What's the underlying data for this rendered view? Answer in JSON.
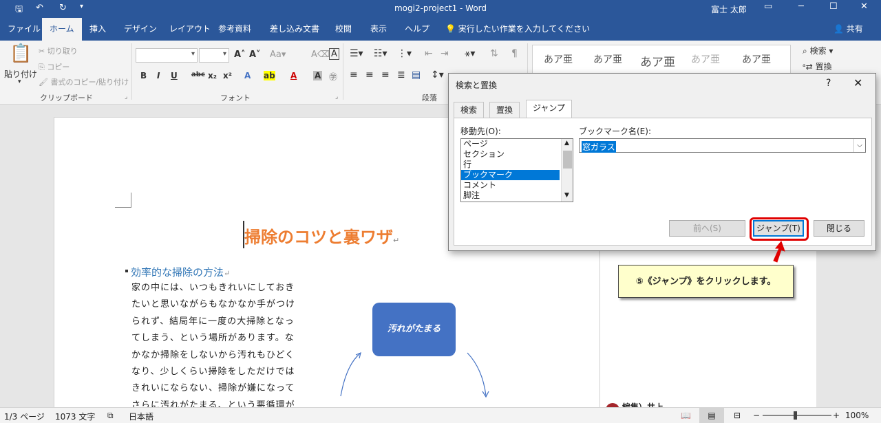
{
  "window": {
    "title": "mogi2-project1  -  Word",
    "user": "富士 太郎"
  },
  "tabs": [
    "ファイル",
    "ホーム",
    "挿入",
    "デザイン",
    "レイアウト",
    "参考資料",
    "差し込み文書",
    "校閲",
    "表示",
    "ヘルプ"
  ],
  "tell_me": "実行したい作業を入力してください",
  "share": "共有",
  "ribbon": {
    "clipboard": {
      "paste": "貼り付け",
      "cut": "切り取り",
      "copy": "コピー",
      "format_painter": "書式のコピー/貼り付け",
      "group": "クリップボード"
    },
    "font": {
      "group": "フォント"
    },
    "paragraph": {
      "group": "段落"
    },
    "styles": [
      "あア亜",
      "あア亜",
      "あア亜",
      "あア亜",
      "あア亜"
    ],
    "editing": {
      "find": "検索",
      "replace": "置換"
    }
  },
  "document": {
    "title": "掃除のコツと裏ワザ",
    "subheading": "効率的な掃除の方法",
    "body": "家の中には、いつもきれいにしておきたいと思いながらもなかなか手がつけられず、結局年に一度の大掃除となってしまう、という場所があります。なかなか掃除をしないから汚れもひどくなり、少しくらい掃除をしただけではきれいにならない、掃除が嫌になってさらに汚れがたまる、という悪循環が発",
    "shape_text": "汚れがたまる"
  },
  "callout": "⑤《ジャンプ》をクリックします。",
  "pane": {
    "edit_label": "編集）井上"
  },
  "dialog": {
    "title": "検索と置換",
    "help": "?",
    "close": "✕",
    "tabs": [
      "検索",
      "置換",
      "ジャンプ"
    ],
    "goto_label": "移動先(O):",
    "goto_items": [
      "ページ",
      "セクション",
      "行",
      "ブックマーク",
      "コメント",
      "脚注"
    ],
    "selected_index": 3,
    "bookmark_label": "ブックマーク名(E):",
    "bookmark_value": "窓ガラス",
    "buttons": {
      "previous": "前へ(S)",
      "jump": "ジャンプ(T)",
      "close": "閉じる"
    }
  },
  "status": {
    "page": "1/3 ページ",
    "words": "1073 文字",
    "language": "日本語",
    "zoom": "100%"
  },
  "colors": {
    "brand": "#2b579a",
    "accent": "#ed7d31",
    "heading": "#2e74b5",
    "shape": "#4472c4",
    "highlight": "#e00000"
  }
}
